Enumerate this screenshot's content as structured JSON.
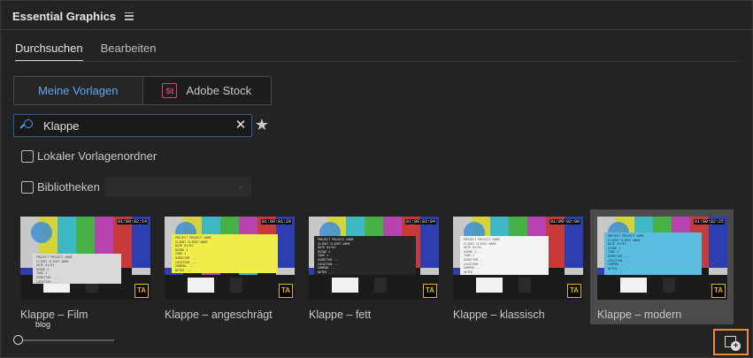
{
  "panel": {
    "title": "Essential Graphics",
    "menu_icon": "hamburger-icon"
  },
  "tabs": [
    {
      "label": "Durchsuchen",
      "active": true
    },
    {
      "label": "Bearbeiten",
      "active": false
    }
  ],
  "source_toggle": {
    "my_templates": "Meine Vorlagen",
    "adobe_stock": "Adobe Stock",
    "stock_logo_text": "St",
    "active_color": "#5ea8f2"
  },
  "search": {
    "value": "Klappe",
    "icon": "search-icon",
    "clear_icon": "close-icon",
    "favorite_icon": "star-icon"
  },
  "filters": {
    "local_folder_label": "Lokaler Vorlagenordner",
    "local_folder_checked": false,
    "libraries_label": "Bibliotheken",
    "libraries_checked": false,
    "libraries_dropdown_value": ""
  },
  "templates": [
    {
      "label": "Klappe – Film",
      "timecode": "01:00:02:14",
      "slate_color": "#d9d9d9",
      "text_color": "#444",
      "badge": "TA",
      "selected": false,
      "sublabel": "blog"
    },
    {
      "label": "Klappe – angeschrägt",
      "timecode": "01:00:01:29",
      "slate_color": "#f0ec4a",
      "text_color": "#333",
      "badge": "TA",
      "selected": false
    },
    {
      "label": "Klappe – fett",
      "timecode": "01:00:02:04",
      "slate_color": "#262626",
      "text_color": "#e6e6e6",
      "badge": "TA",
      "selected": false
    },
    {
      "label": "Klappe – klassisch",
      "timecode": "01:00:02:08",
      "slate_color": "#f4f4f4",
      "text_color": "#555",
      "badge": "TA",
      "selected": false
    },
    {
      "label": "Klappe – modern",
      "timecode": "01:00:02:25",
      "slate_color": "#5bbde0",
      "text_color": "#0b2c4a",
      "badge": "TA",
      "selected": true
    }
  ],
  "slate_lines": [
    "PROJECT  PROJECT NAME",
    "CLIENT  CLIENT NAME",
    "DATE  01/01",
    "SCENE  1",
    "TAKE  1",
    "DIRECTOR  ...",
    "LOCATION  ...",
    "CAMERA  ...",
    "NOTES  ..."
  ],
  "footer": {
    "zoom_slider_level": 0,
    "new_item_icon": "new-graphic-icon",
    "highlight_color": "#f08c1e"
  }
}
